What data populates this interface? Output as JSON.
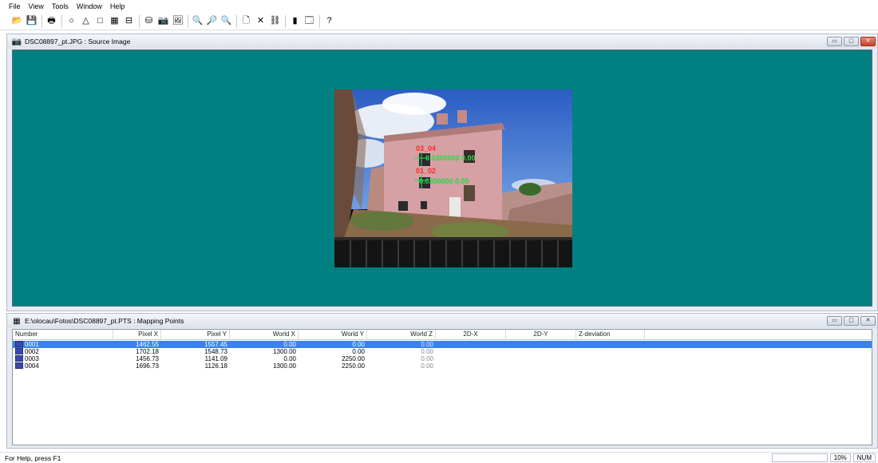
{
  "menu": [
    "File",
    "View",
    "Tools",
    "Window",
    "Help"
  ],
  "toolbar": [
    {
      "name": "open-icon",
      "glyph": "📂"
    },
    {
      "name": "save-icon",
      "glyph": "💾"
    },
    {
      "sep": true
    },
    {
      "name": "print-icon",
      "glyph": "🖶"
    },
    {
      "sep": true
    },
    {
      "name": "circle-icon",
      "glyph": "○"
    },
    {
      "name": "triangle-icon",
      "glyph": "△"
    },
    {
      "name": "rectangle-icon",
      "glyph": "□"
    },
    {
      "name": "grid-icon",
      "glyph": "▦"
    },
    {
      "name": "table-icon",
      "glyph": "⊟"
    },
    {
      "sep": true
    },
    {
      "name": "database-icon",
      "glyph": "⛁"
    },
    {
      "name": "camera-icon",
      "glyph": "📷"
    },
    {
      "name": "images-icon",
      "glyph": "🖼"
    },
    {
      "sep": true
    },
    {
      "name": "zoom-in-icon",
      "glyph": "🔍"
    },
    {
      "name": "zoom-out-icon",
      "glyph": "🔎"
    },
    {
      "name": "zoom-fit-icon",
      "glyph": "🔍"
    },
    {
      "sep": true
    },
    {
      "name": "new-icon",
      "glyph": "🗋"
    },
    {
      "name": "delete-icon",
      "glyph": "✕"
    },
    {
      "name": "link-icon",
      "glyph": "⛓"
    },
    {
      "sep": true
    },
    {
      "name": "color-bars-icon",
      "glyph": "▮"
    },
    {
      "name": "properties-icon",
      "glyph": "🗔"
    },
    {
      "sep": true
    },
    {
      "name": "help-icon",
      "glyph": "?"
    }
  ],
  "image_window": {
    "title": "DSC08897_pt.JPG : Source Image",
    "labels": [
      {
        "text": "03_04",
        "color": "#ff2a2a"
      },
      {
        "text": "0.0300000 0.00",
        "color": "#22dd44"
      },
      {
        "text": "01_02",
        "color": "#ff2a2a"
      },
      {
        "text": "0.0300000 0.00",
        "color": "#22dd44"
      }
    ]
  },
  "points_window": {
    "title": "E:\\olocau\\Fotos\\DSC08897_pt.PTS :  Mapping Points",
    "columns": [
      "Number",
      "Pixel X",
      "Pixel Y",
      "World X",
      "World Y",
      "World Z",
      "2D-X",
      "2D-Y",
      "Z-deviation"
    ],
    "rows": [
      [
        "0001",
        "1462.55",
        "1557.45",
        "0.00",
        "0.00",
        "0.00",
        "",
        "",
        ""
      ],
      [
        "0002",
        "1702.18",
        "1548.73",
        "1300.00",
        "0.00",
        "0.00",
        "",
        "",
        ""
      ],
      [
        "0003",
        "1456.73",
        "1141.09",
        "0.00",
        "2250.00",
        "0.00",
        "",
        "",
        ""
      ],
      [
        "0004",
        "1696.73",
        "1126.18",
        "1300.00",
        "2250.00",
        "0.00",
        "",
        "",
        ""
      ]
    ],
    "selected_row": 0
  },
  "status": {
    "text": "For Help, press F1",
    "zoom": "10%",
    "num": "NUM"
  }
}
